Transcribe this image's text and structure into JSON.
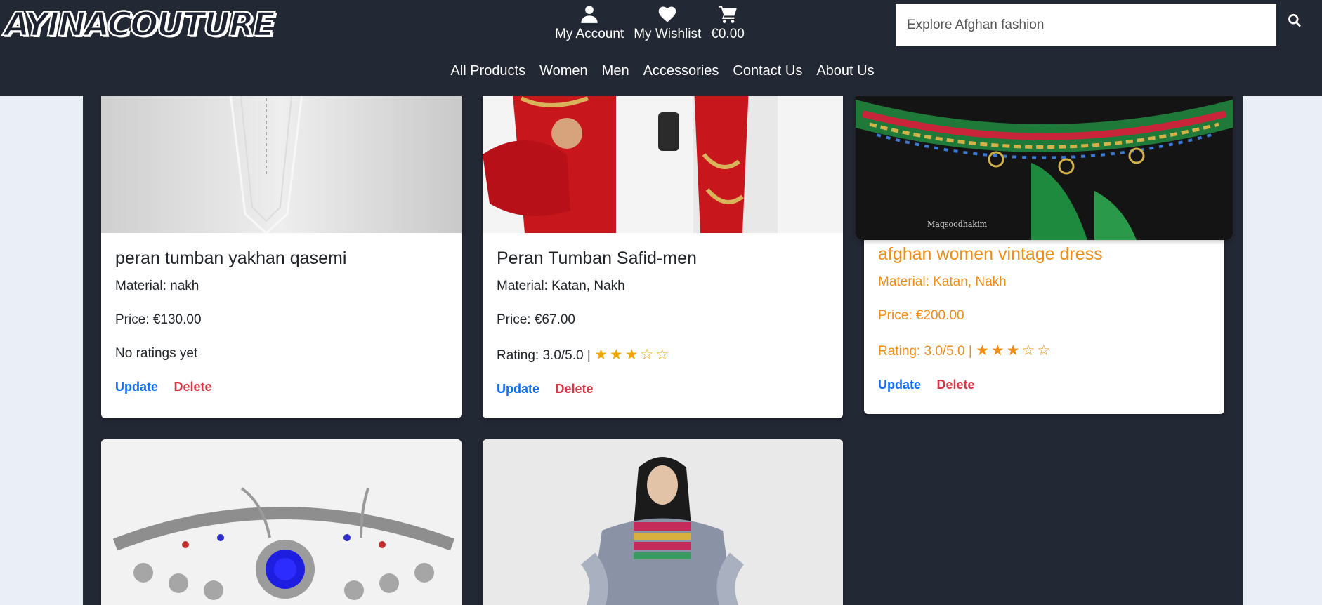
{
  "brand": {
    "logo_text": "AYINACOUTURE"
  },
  "header": {
    "account_label": "My Account",
    "wishlist_label": "My Wishlist",
    "cart_total": "€0.00",
    "search_placeholder": "Explore Afghan fashion"
  },
  "nav": {
    "items": [
      "All Products",
      "Women",
      "Men",
      "Accessories",
      "Contact Us",
      "About Us"
    ]
  },
  "products": [
    {
      "title": "peran tumban yakhan qasemi",
      "material": "Material: nakh",
      "price": "Price: €130.00",
      "rating": "No ratings yet",
      "update_label": "Update",
      "delete_label": "Delete"
    },
    {
      "title": "Peran Tumban Safid-men",
      "material": "Material: Katan, Nakh",
      "price": "Price: €67.00",
      "rating": "Rating: 3.0/5.0 |",
      "stars": "★★★☆☆",
      "update_label": "Update",
      "delete_label": "Delete"
    },
    {
      "title": "afghan women vintage dress",
      "material": "Material: Katan, Nakh",
      "price": "Price: €200.00",
      "rating": "Rating: 3.0/5.0 |",
      "stars": "★★★☆☆",
      "photo_credit": "Maqsoodhakim",
      "update_label": "Update",
      "delete_label": "Delete"
    }
  ],
  "colors": {
    "header_bg": "#222834",
    "link_blue": "#0d6efd",
    "link_red": "#dc3545",
    "highlight_orange": "#f28c12"
  }
}
